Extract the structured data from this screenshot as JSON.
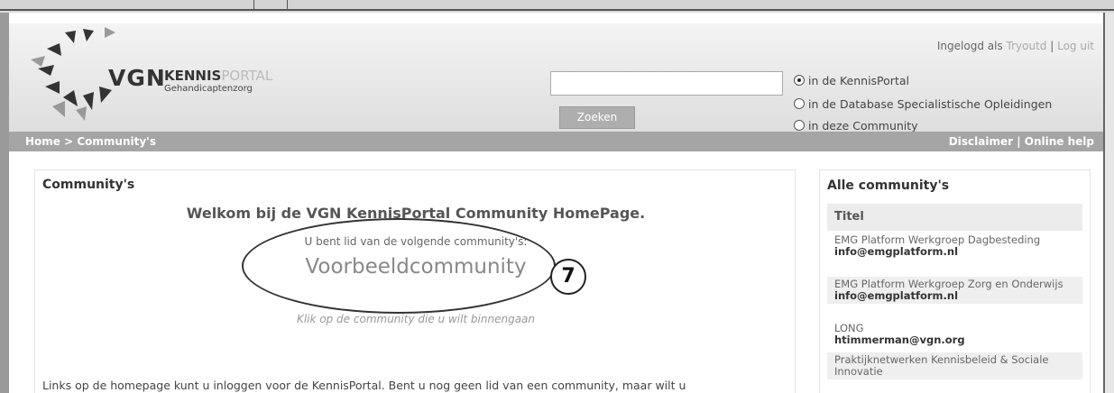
{
  "header": {
    "logo_vgn": "VGN",
    "logo_kennis": "KENNIS",
    "logo_portal": "PORTAL",
    "logo_sub": "Gehandicaptenzorg",
    "login_prefix": "Ingelogd als",
    "username": "Tryoutd",
    "separator": "|",
    "logout_label": "Log uit"
  },
  "search": {
    "value": "",
    "button_label": "Zoeken",
    "options": [
      {
        "label": "in de KennisPortal",
        "selected": true
      },
      {
        "label": "in de Database Specialistische Opleidingen",
        "selected": false
      },
      {
        "label": "in deze Community",
        "selected": false
      }
    ]
  },
  "nav": {
    "breadcrumb": "Home > Community's",
    "disclaimer": "Disclaimer",
    "divider": "|",
    "help": "Online help"
  },
  "main": {
    "title": "Community's",
    "welcome": "Welkom bij de VGN KennisPortal Community HomePage.",
    "member_of": "U bent lid van de volgende community's:",
    "community": "Voorbeeldcommunity",
    "click_hint": "Klik op de community die u wilt binnengaan",
    "bottom_text": "Links op de homepage kunt u inloggen voor de KennisPortal. Bent u nog geen lid van een community, maar wilt u"
  },
  "annotation": {
    "number": "7"
  },
  "sidebar": {
    "title": "Alle community's",
    "column_header": "Titel",
    "items": [
      {
        "name": "EMG Platform Werkgroep Dagbesteding",
        "email": "info@emgplatform.nl"
      },
      {
        "name": "EMG Platform Werkgroep Zorg en Onderwijs",
        "email": "info@emgplatform.nl"
      },
      {
        "name": "LONG",
        "email": "htimmerman@vgn.org"
      },
      {
        "name": "Praktijknetwerken Kennisbeleid & Sociale Innovatie",
        "email": ""
      }
    ]
  },
  "colors": {
    "nav_bar": "#a5a5a5",
    "button": "#aeaeae",
    "accent_text": "#aaaaaa"
  }
}
